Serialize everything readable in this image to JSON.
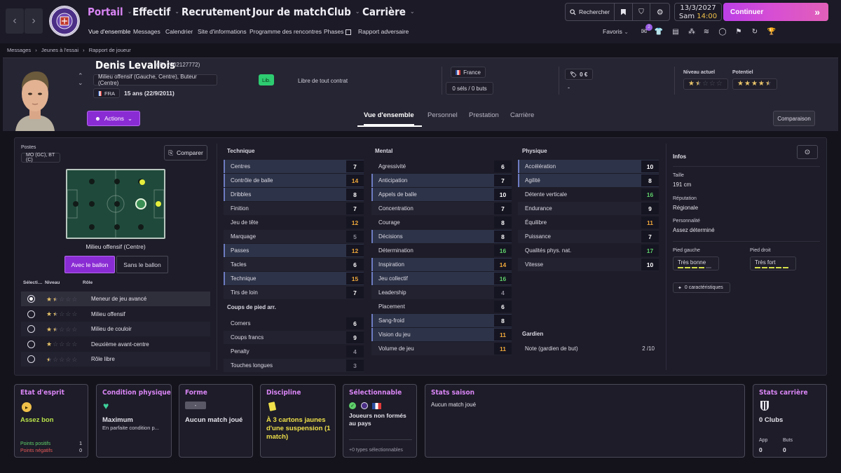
{
  "topbar": {
    "crest_text": "TOULOUSE FOOTBALL CLUB",
    "main_nav": [
      {
        "label": "Portail",
        "active": true
      },
      {
        "label": "Effectif"
      },
      {
        "label": "Recrutement"
      },
      {
        "label": "Jour de match"
      },
      {
        "label": "Club"
      },
      {
        "label": "Carrière"
      }
    ],
    "sub_nav": [
      "Vue d'ensemble",
      "Messages",
      "Calendrier",
      "Site d'informations",
      "Programme des rencontres",
      "Phases",
      "Rapport adversaire"
    ],
    "search_label": "Rechercher",
    "date": "13/3/2027",
    "day_time": "Sam 14:00",
    "day": "Sam",
    "time": "14:00",
    "continue_label": "Continuer",
    "favorites_label": "Favoris",
    "favorites_badge": "2"
  },
  "breadcrumb": [
    "Messages",
    "Jeunes à l'essai",
    "Rapport de joueur"
  ],
  "player": {
    "name": "Denis Levallois",
    "id": "(ID: 2002127772)",
    "positions_long": "Milieu offensif (Gauche, Centre), Buteur (Centre)",
    "nationality_code": "FRA",
    "age": "15 ans (22/9/2011)",
    "status_chip": "Lib.",
    "contract": "Libre de tout contrat",
    "intl_country": "France",
    "intl_stats": "0 séls / 0 buts",
    "value": "0 €",
    "value_sub": "-",
    "current_label": "Niveau actuel",
    "potential_label": "Potentiel",
    "current_stars": 1.5,
    "potential_stars": 4.5,
    "actions_label": "Actions",
    "compare_label": "Comparaison"
  },
  "tabs": [
    "Vue d'ensemble",
    "Personnel",
    "Prestation",
    "Carrière"
  ],
  "positions_panel": {
    "title": "Postes",
    "codes": "MO (GC), BT (C)",
    "compare_btn": "Comparer",
    "pitch_caption": "Milieu offensif (Centre)",
    "mode_on": "Avec le ballon",
    "mode_off": "Sans le ballon",
    "role_headers": [
      "Sélecti…",
      "Niveau",
      "Rôle"
    ],
    "roles": [
      {
        "name": "Meneur de jeu avancé",
        "stars": 1.5,
        "selected": true
      },
      {
        "name": "Milieu offensif",
        "stars": 1.5,
        "selected": false
      },
      {
        "name": "Milieu de couloir",
        "stars": 1.5,
        "selected": false
      },
      {
        "name": "Deuxième avant-centre",
        "stars": 1,
        "selected": false
      },
      {
        "name": "Rôle libre",
        "stars": 0.5,
        "selected": false
      }
    ]
  },
  "attributes": {
    "technique_title": "Technique",
    "technique": [
      {
        "name": "Centres",
        "value": "7",
        "hl": true
      },
      {
        "name": "Contrôle de balle",
        "value": "14",
        "hl": true,
        "c": "o"
      },
      {
        "name": "Dribbles",
        "value": "8",
        "hl": true
      },
      {
        "name": "Finition",
        "value": "7"
      },
      {
        "name": "Jeu de tête",
        "value": "12",
        "c": "o"
      },
      {
        "name": "Marquage",
        "value": "5",
        "c": "m"
      },
      {
        "name": "Passes",
        "value": "12",
        "hl": true,
        "c": "o"
      },
      {
        "name": "Tacles",
        "value": "6"
      },
      {
        "name": "Technique",
        "value": "15",
        "hl": true,
        "c": "o"
      },
      {
        "name": "Tirs de loin",
        "value": "7"
      }
    ],
    "setpieces_title": "Coups de pied arr.",
    "setpieces": [
      {
        "name": "Corners",
        "value": "6"
      },
      {
        "name": "Coups francs",
        "value": "9"
      },
      {
        "name": "Penalty",
        "value": "4",
        "c": "m"
      },
      {
        "name": "Touches longues",
        "value": "3",
        "c": "m"
      }
    ],
    "mental_title": "Mental",
    "mental": [
      {
        "name": "Agressivité",
        "value": "6"
      },
      {
        "name": "Anticipation",
        "value": "7",
        "hl": true
      },
      {
        "name": "Appels de balle",
        "value": "10",
        "hl": true
      },
      {
        "name": "Concentration",
        "value": "7"
      },
      {
        "name": "Courage",
        "value": "8"
      },
      {
        "name": "Décisions",
        "value": "8",
        "hl": true
      },
      {
        "name": "Détermination",
        "value": "16",
        "c": "g"
      },
      {
        "name": "Inspiration",
        "value": "14",
        "hl": true,
        "c": "o"
      },
      {
        "name": "Jeu collectif",
        "value": "16",
        "hl": true,
        "c": "g"
      },
      {
        "name": "Leadership",
        "value": "4",
        "c": "m"
      },
      {
        "name": "Placement",
        "value": "6"
      },
      {
        "name": "Sang-froid",
        "value": "8",
        "hl": true
      },
      {
        "name": "Vision du jeu",
        "value": "11",
        "hl": true,
        "c": "o"
      },
      {
        "name": "Volume de jeu",
        "value": "11",
        "c": "o"
      }
    ],
    "physical_title": "Physique",
    "physical": [
      {
        "name": "Accélération",
        "value": "10",
        "hl": true
      },
      {
        "name": "Agilité",
        "value": "8",
        "hl": true
      },
      {
        "name": "Détente verticale",
        "value": "16",
        "c": "g"
      },
      {
        "name": "Endurance",
        "value": "9"
      },
      {
        "name": "Équilibre",
        "value": "11",
        "c": "o"
      },
      {
        "name": "Puissance",
        "value": "7"
      },
      {
        "name": "Qualités phys. nat.",
        "value": "17",
        "c": "g"
      },
      {
        "name": "Vitesse",
        "value": "10"
      }
    ],
    "gk_title": "Gardien",
    "gk_label": "Note (gardien de but)",
    "gk_value": "2 /10"
  },
  "info": {
    "title": "Infos",
    "height_label": "Taille",
    "height": "191 cm",
    "rep_label": "Réputation",
    "rep": "Régionale",
    "pers_label": "Personnalité",
    "pers": "Assez déterminé",
    "lf_label": "Pied gauche",
    "lf": "Très bonne",
    "lf_level": 4,
    "rf_label": "Pied droit",
    "rf": "Très fort",
    "rf_level": 5,
    "traits": "0 caractéristiques"
  },
  "cards": {
    "morale": {
      "title": "Etat d'esprit",
      "value": "Assez bon",
      "pos_label": "Points positifs",
      "pos": "1",
      "neg_label": "Points négatifs",
      "neg": "0"
    },
    "condition": {
      "title": "Condition physique",
      "value": "Maximum",
      "sub": "En parfaite condition p..."
    },
    "form": {
      "title": "Forme",
      "badge": "-",
      "value": "Aucun match joué"
    },
    "discipline": {
      "title": "Discipline",
      "value": "À 3 cartons jaunes d'une suspension (1 match)"
    },
    "selectable": {
      "title": "Sélectionnable",
      "value": "Joueurs non formés au pays",
      "sub": "+0 types sélectionnables"
    },
    "season": {
      "title": "Stats saison",
      "value": "Aucun match joué"
    },
    "career": {
      "title": "Stats carrière",
      "value": "0 Clubs",
      "app_label": "App",
      "app": "0",
      "goals_label": "Buts",
      "goals": "0"
    }
  },
  "colors": {
    "accent": "#d985f4",
    "green": "#5fd06a",
    "orange": "#f0a93b",
    "button": "#8a2cd4"
  }
}
